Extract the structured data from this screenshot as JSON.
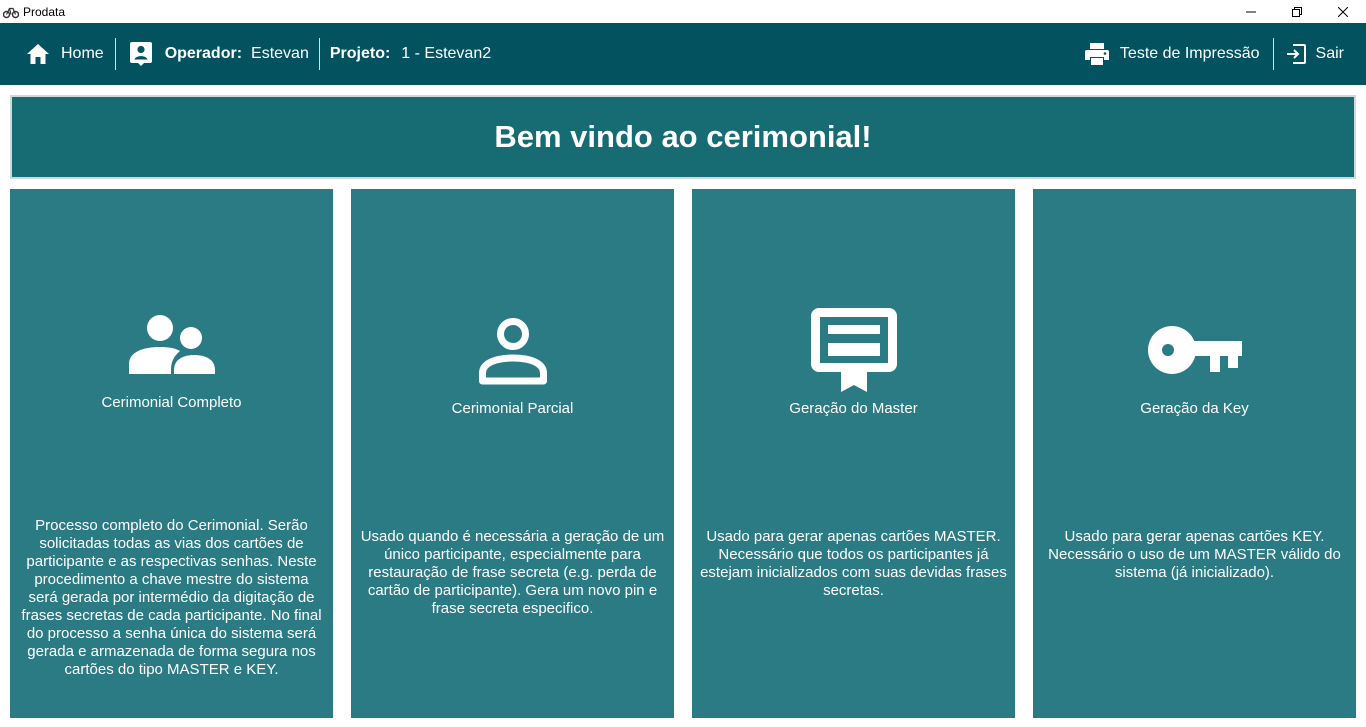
{
  "window": {
    "title": "Prodata",
    "app_icon": "bike-icon"
  },
  "nav": {
    "home_label": "Home",
    "operator_label": "Operador:",
    "operator_value": "Estevan",
    "project_label": "Projeto:",
    "project_value": "1 - Estevan2",
    "print_test_label": "Teste de Impressão",
    "logout_label": "Sair"
  },
  "welcome": {
    "title": "Bem vindo ao cerimonial!"
  },
  "cards": [
    {
      "icon": "users-icon",
      "title": "Cerimonial Completo",
      "description": "Processo completo do Cerimonial. Serão solicitadas todas as vias dos cartões de participante e as respectivas senhas. Neste procedimento a chave mestre do sistema será gerada por intermédio da digitação de frases secretas de cada participante. No final do processo a senha única do sistema será gerada e armazenada de forma segura nos cartões do tipo MASTER e KEY."
    },
    {
      "icon": "user-icon",
      "title": "Cerimonial Parcial",
      "description": "Usado quando é necessária a geração de um único participante, especialmente para restauração de frase secreta (e.g. perda de cartão de participante). Gera um novo pin e frase secreta especifico."
    },
    {
      "icon": "certificate-card-icon",
      "title": "Geração do Master",
      "description": "Usado para gerar apenas cartões MASTER. Necessário que todos os participantes já estejam inicializados com suas devidas frases secretas."
    },
    {
      "icon": "key-icon",
      "title": "Geração da Key",
      "description": "Usado para gerar apenas cartões KEY. Necessário o uso de um MASTER válido do sistema (já inicializado)."
    }
  ],
  "colors": {
    "nav_bg": "#025260",
    "welcome_bg": "#176b73",
    "card_bg": "#2b7b85",
    "text": "#ffffff"
  }
}
